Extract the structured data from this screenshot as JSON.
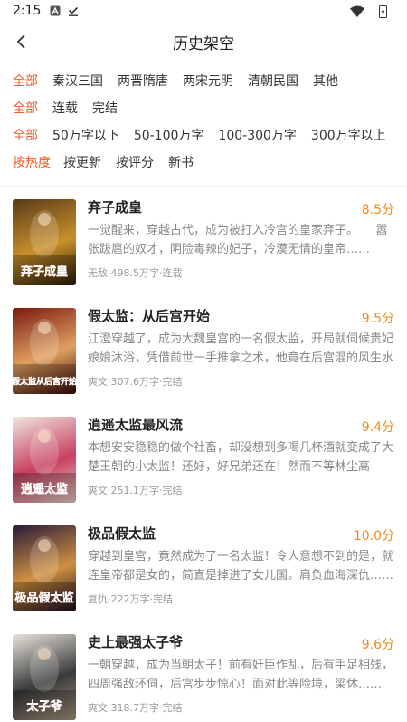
{
  "status": {
    "time": "2:15"
  },
  "header": {
    "title": "历史架空"
  },
  "filters": [
    {
      "items": [
        "全部",
        "秦汉三国",
        "两晋隋唐",
        "两宋元明",
        "清朝民国",
        "其他"
      ],
      "active": 0
    },
    {
      "items": [
        "全部",
        "连载",
        "完结"
      ],
      "active": 0
    },
    {
      "items": [
        "全部",
        "50万字以下",
        "50-100万字",
        "100-300万字",
        "300万字以上"
      ],
      "active": 0
    },
    {
      "items": [
        "按热度",
        "按更新",
        "按评分",
        "新书"
      ],
      "active": 0
    }
  ],
  "books": [
    {
      "title": "弃子成皇",
      "score": "8.5分",
      "desc": "一觉醒来，穿越古代，成为被打入冷宫的皇家弃子。　　嚣张跋扈的奴才，阴险毒辣的妃子，冷漠无情的皇帝……",
      "meta": "无敌·498.5万字·连载",
      "cover_text": "弃子成皇",
      "cover_colors": [
        "#5a3a1a",
        "#c8902a",
        "#2a1a0a"
      ]
    },
    {
      "title": "假太监：从后宫开始",
      "score": "9.5分",
      "desc": "江澄穿越了，成为大魏皇宫的一名假太监，开局就伺候贵妃娘娘沐浴，凭借前世一手推拿之术，他竟在后宫混的风生水起……",
      "meta": "爽文·307.6万字·完结",
      "cover_text": "假太监从后宫开始",
      "cover_colors": [
        "#7a1a10",
        "#e0a060",
        "#3a0a08"
      ]
    },
    {
      "title": "逍遥太监最风流",
      "score": "9.4分",
      "desc": "本想安安稳稳的做个社畜，却没想到多喝几杯酒就变成了大楚王朝的小太监！还好，好兄弟还在！然而不等林尘高兴……",
      "meta": "爽文·251.1万字·完结",
      "cover_text": "逍遥太监",
      "cover_colors": [
        "#f0e6e0",
        "#c84060",
        "#e8d0c8"
      ]
    },
    {
      "title": "极品假太监",
      "score": "10.0分",
      "desc": "穿越到皇宫，竟然成为了一名太监！令人意想不到的是，就连皇帝都是女的，简直是掉进了女儿国。肩负血海深仇……",
      "meta": "复仇·222万字·完结",
      "cover_text": "极品假太监",
      "cover_colors": [
        "#2a1a3a",
        "#d09040",
        "#1a0a20"
      ]
    },
    {
      "title": "史上最强太子爷",
      "score": "9.6分",
      "desc": "一朝穿越，成为当朝太子！前有奸臣作乱，后有手足相残，四周强敌环伺，后宫步步惊心！面对此等险境，梁休……",
      "meta": "爽文·318.7万字·完结",
      "cover_text": "太子爷",
      "cover_colors": [
        "#e8e4dc",
        "#3a3a3a",
        "#a89880"
      ]
    }
  ]
}
